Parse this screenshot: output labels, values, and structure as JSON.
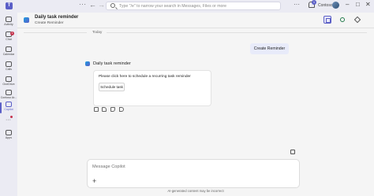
{
  "titlebar": {
    "more_label": "···",
    "back_label": "←",
    "forward_label": "→",
    "search_placeholder": "Type \"/e\" to narrow your search in Messages, Files or more",
    "more_options_label": "···",
    "notification_count": "1",
    "org_name": "Contoso",
    "minimize_label": "–",
    "maximize_label": "□",
    "close_label": "✕"
  },
  "rail": {
    "items": [
      {
        "label": "Activity"
      },
      {
        "label": "Chat",
        "badge": "1"
      },
      {
        "label": "Calendar"
      },
      {
        "label": "Calls"
      },
      {
        "label": "OneDrive"
      },
      {
        "label": "Contoso Ar..."
      },
      {
        "label": "Copilot"
      },
      {
        "label": "Apps"
      }
    ],
    "more_label": "···"
  },
  "header": {
    "title": "Daily task reminder",
    "subtitle": "Create Reminder"
  },
  "conversation": {
    "date_divider": "Today",
    "user_message": "Create Reminder",
    "bot_name": "Daily task reminder",
    "card_text": "Please click here to schedule a recurring task reminder",
    "card_button": "Schedule task"
  },
  "composer": {
    "placeholder": "Message Copilot",
    "add_label": "+",
    "disclaimer": "AI-generated content may be incorrect"
  },
  "colors": {
    "accent": "#5b5fc7",
    "badge": "#c4314b",
    "user_bubble": "#e8ebfa"
  }
}
